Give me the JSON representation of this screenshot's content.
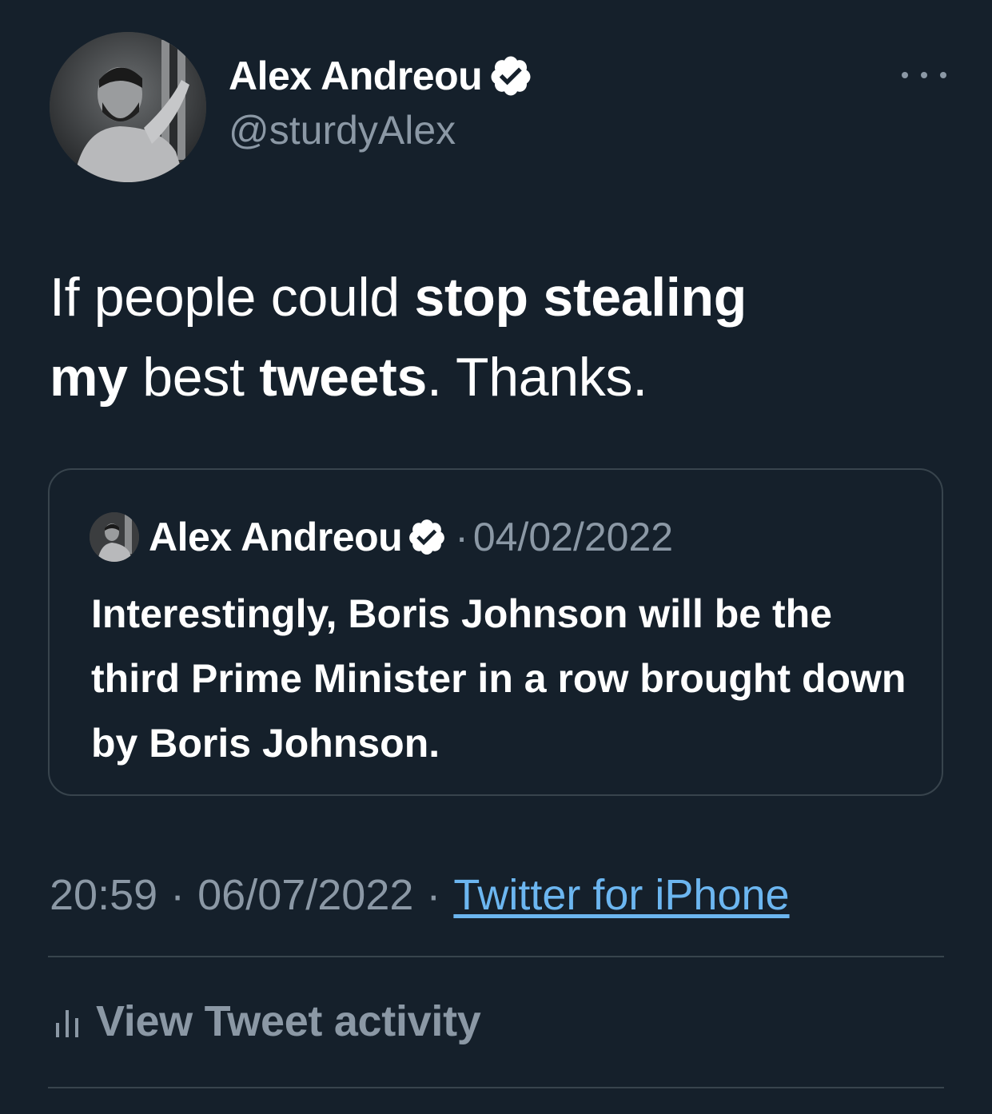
{
  "author": {
    "display_name": "Alex Andreou",
    "handle": "@sturdyAlex",
    "avatar_icon": "user-photo-avatar",
    "verified_icon": "verified-badge-icon"
  },
  "tweet": {
    "text_parts": [
      {
        "text": "If people could ",
        "bold": false
      },
      {
        "text": "stop stealing",
        "bold": true
      },
      {
        "text": " ",
        "bold": false
      },
      {
        "text": "my",
        "bold": true
      },
      {
        "text": " best ",
        "bold": false
      },
      {
        "text": "tweets",
        "bold": true
      },
      {
        "text": ". Thanks.",
        "bold": false
      }
    ]
  },
  "quoted_tweet": {
    "display_name": "Alex Andreou",
    "separator": "·",
    "date": "04/02/2022",
    "text": "Interestingly, Boris Johnson will be the third Prime Minister in a row brought down by Boris Johnson."
  },
  "meta": {
    "time": "20:59",
    "separator": "·",
    "date": "06/07/2022",
    "source": "Twitter for iPhone"
  },
  "actions": {
    "more_icon": "more-options-icon",
    "activity_label": "View Tweet activity",
    "activity_icon": "bar-chart-icon"
  },
  "colors": {
    "background": "#15202b",
    "text_primary": "#ffffff",
    "text_secondary": "#8b98a5",
    "link": "#6cb6f0",
    "border": "#38444d"
  }
}
